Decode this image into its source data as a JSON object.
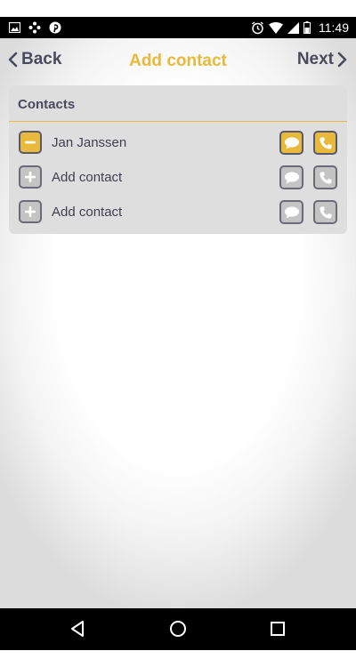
{
  "status_bar": {
    "time": "11:49",
    "left_icons": [
      "image-icon",
      "dots-cluster-icon",
      "pinterest-icon"
    ],
    "right_icons": [
      "alarm-icon",
      "wifi-icon",
      "signal-icon",
      "battery-icon"
    ]
  },
  "nav": {
    "back_label": "Back",
    "title": "Add contact",
    "next_label": "Next"
  },
  "contacts_panel": {
    "title": "Contacts",
    "rows": [
      {
        "label": "Jan Janssen",
        "state": "active",
        "left_icon": "minus-icon"
      },
      {
        "label": "Add contact",
        "state": "empty",
        "left_icon": "plus-icon"
      },
      {
        "label": "Add contact",
        "state": "empty",
        "left_icon": "plus-icon"
      }
    ]
  },
  "bottom_nav": {
    "icons": [
      "back-triangle-icon",
      "home-circle-icon",
      "recents-square-icon"
    ]
  },
  "colors": {
    "accent": "#e8b93a",
    "text_dark": "#4a4a5e",
    "panel_bg": "#dedede",
    "status_bar": "#000000",
    "nav_bar": "#000000"
  }
}
